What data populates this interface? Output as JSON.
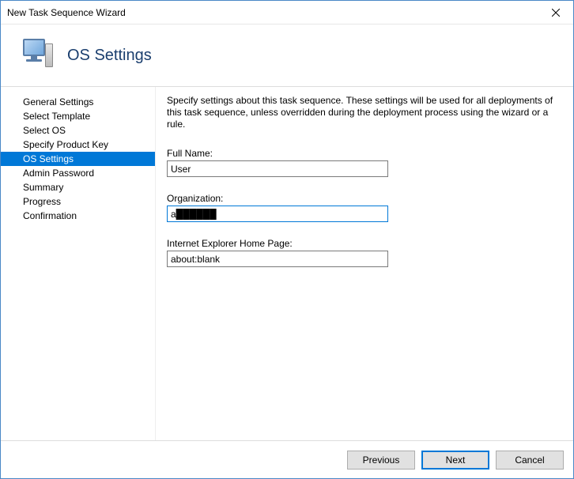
{
  "window": {
    "title": "New Task Sequence Wizard"
  },
  "header": {
    "title": "OS Settings"
  },
  "sidebar": {
    "items": [
      {
        "label": "General Settings",
        "selected": false
      },
      {
        "label": "Select Template",
        "selected": false
      },
      {
        "label": "Select OS",
        "selected": false
      },
      {
        "label": "Specify Product Key",
        "selected": false
      },
      {
        "label": "OS Settings",
        "selected": true
      },
      {
        "label": "Admin Password",
        "selected": false
      },
      {
        "label": "Summary",
        "selected": false
      },
      {
        "label": "Progress",
        "selected": false
      },
      {
        "label": "Confirmation",
        "selected": false
      }
    ]
  },
  "main": {
    "description": "Specify settings about this task sequence.  These settings will be used for all deployments of this task sequence, unless overridden during the deployment process using the wizard or a rule.",
    "fields": {
      "fullname_label": "Full Name:",
      "fullname_value": "User",
      "organization_label": "Organization:",
      "organization_value": "a██████",
      "iehome_label": "Internet Explorer Home Page:",
      "iehome_value": "about:blank"
    }
  },
  "footer": {
    "previous": "Previous",
    "next": "Next",
    "cancel": "Cancel"
  }
}
